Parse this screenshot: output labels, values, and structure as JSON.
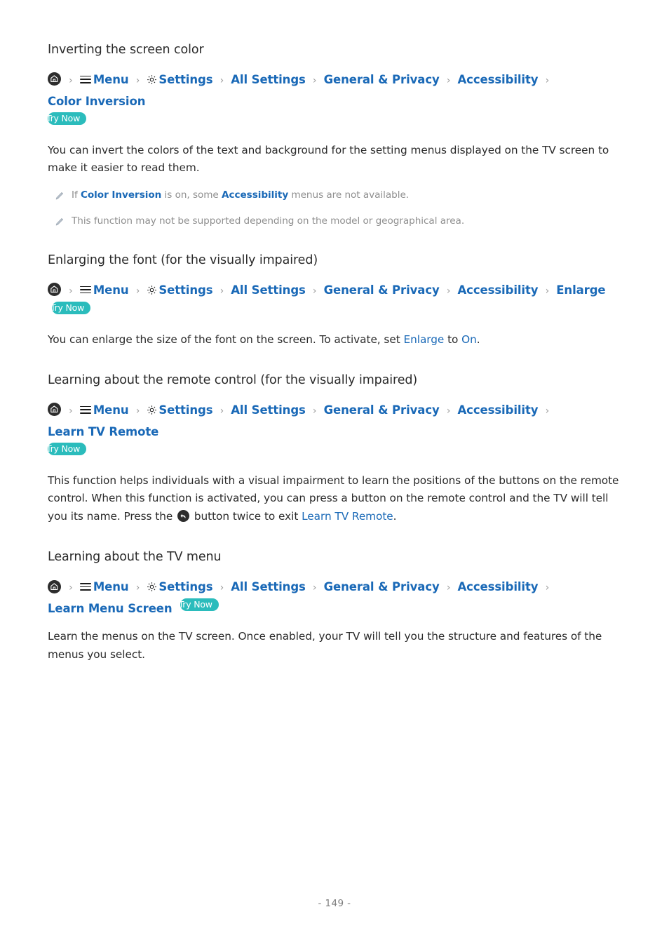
{
  "document": {
    "page_number": "- 149 -"
  },
  "icons": {
    "home": "home-icon",
    "menu": "hamburger-menu-icon",
    "gear": "gear-icon",
    "return": "return-icon",
    "pencil": "pencil-note-icon",
    "chevron": "chevron-right-separator"
  },
  "colors": {
    "link_blue": "#1a69b7",
    "badge_teal": "#2bbcbc",
    "body_text": "#2b2b2b",
    "note_text": "#8e8e8e",
    "icon_dark": "#2d2d2d"
  },
  "common": {
    "separator": "›",
    "try_now": "Try Now",
    "crumb_menu": "Menu",
    "crumb_settings": "Settings",
    "crumb_all_settings": "All Settings",
    "crumb_general_privacy": "General & Privacy",
    "crumb_accessibility": "Accessibility"
  },
  "sections": [
    {
      "id": "color-inversion",
      "title": "Inverting the screen color",
      "path_last": "Color Inversion",
      "body": "You can invert the colors of the text and background for the setting menus displayed on the TV screen to make it easier to read them.",
      "notes": [
        {
          "pre": "If ",
          "strong1": "Color Inversion",
          "mid": " is on, some ",
          "strong2": "Accessibility",
          "post": " menus are not available."
        },
        {
          "pre": "This function may not be supported depending on the model or geographical area.",
          "strong1": "",
          "mid": "",
          "strong2": "",
          "post": ""
        }
      ]
    },
    {
      "id": "enlarge",
      "title": "Enlarging the font (for the visually impaired)",
      "path_last": "Enlarge",
      "body_pre": "You can enlarge the size of the font on the screen. To activate, set ",
      "body_link1": "Enlarge",
      "body_mid": " to ",
      "body_link2": "On",
      "body_post": "."
    },
    {
      "id": "learn-tv-remote",
      "title": "Learning about the remote control (for the visually impaired)",
      "path_last": "Learn TV Remote",
      "body_pre": "This function helps individuals with a visual impairment to learn the positions of the buttons on the remote control. When this function is activated, you can press a button on the remote control and the TV will tell you its name. Press the ",
      "body_mid": " button twice to exit ",
      "body_link": "Learn TV Remote",
      "body_post": "."
    },
    {
      "id": "learn-menu-screen",
      "title": "Learning about the TV menu",
      "path_last": "Learn Menu Screen",
      "body": "Learn the menus on the TV screen. Once enabled, your TV will tell you the structure and features of the menus you select."
    }
  ]
}
